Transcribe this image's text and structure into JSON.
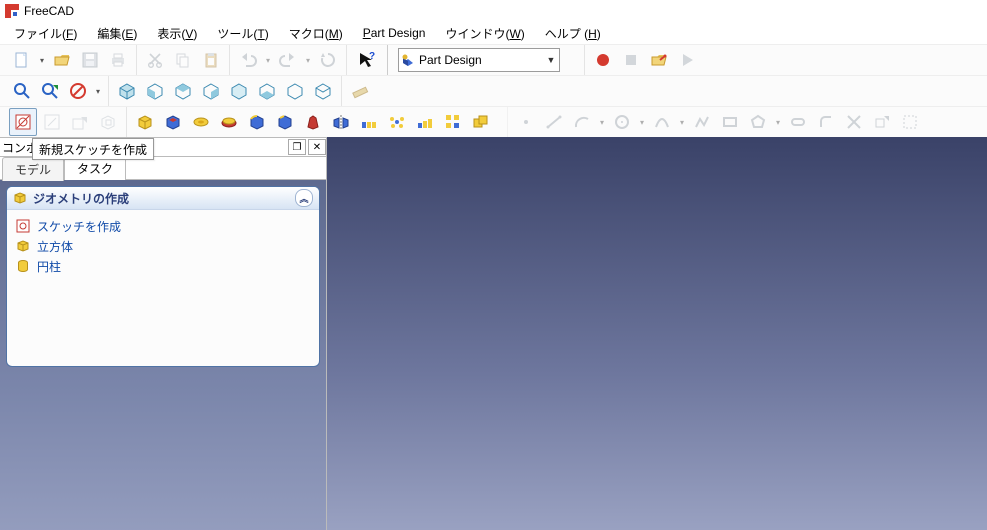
{
  "app": {
    "title": "FreeCAD"
  },
  "menus": [
    {
      "label": "ファイル",
      "mnemonic": "F"
    },
    {
      "label": "編集",
      "mnemonic": "E"
    },
    {
      "label": "表示",
      "mnemonic": "V"
    },
    {
      "label": "ツール",
      "mnemonic": "T"
    },
    {
      "label": "マクロ",
      "mnemonic": "M"
    },
    {
      "label": "Part Design",
      "mnemonic": "P",
      "raw": true
    },
    {
      "label": "ウインドウ",
      "mnemonic": "W"
    },
    {
      "label": "ヘルプ",
      "mnemonic": "H"
    }
  ],
  "workbench": {
    "label": "Part Design"
  },
  "dock": {
    "title": "コンボ",
    "tooltip": "新規スケッチを作成",
    "tabs": {
      "model": "モデル",
      "task": "タスク"
    },
    "task_header": "ジオメトリの作成",
    "items": [
      {
        "label": "スケッチを作成"
      },
      {
        "label": "立方体"
      },
      {
        "label": "円柱"
      }
    ]
  }
}
